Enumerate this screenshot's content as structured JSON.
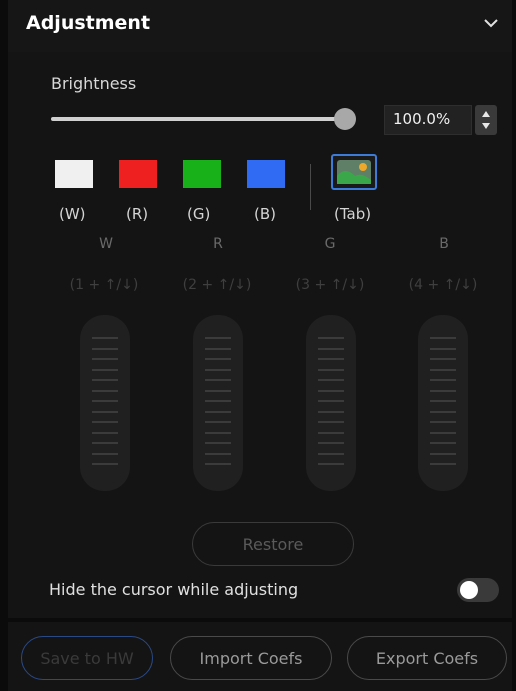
{
  "header": {
    "title": "Adjustment"
  },
  "brightness": {
    "label": "Brightness",
    "value": "100.0%",
    "level": 1.0
  },
  "swatches": [
    {
      "label": "(W)",
      "color": "#f0f0f0"
    },
    {
      "label": "(R)",
      "color": "#ee2020"
    },
    {
      "label": "(G)",
      "color": "#19b11a"
    },
    {
      "label": "(B)",
      "color": "#2f6cf3"
    }
  ],
  "tab": {
    "label": "(Tab)",
    "icon": "landscape-image-icon"
  },
  "channels": [
    {
      "head": "W",
      "key": "(1 + ↑/↓)"
    },
    {
      "head": "R",
      "key": "(2 + ↑/↓)"
    },
    {
      "head": "G",
      "key": "(3 + ↑/↓)"
    },
    {
      "head": "B",
      "key": "(4 + ↑/↓)"
    }
  ],
  "restore_label": "Restore",
  "hide_cursor": {
    "label": "Hide the cursor while adjusting",
    "enabled": false
  },
  "footer": {
    "save_label": "Save to HW",
    "import_label": "Import Coefs",
    "export_label": "Export Coefs"
  },
  "colors": {
    "accent": "#3d7bd8",
    "background": "#141414"
  }
}
